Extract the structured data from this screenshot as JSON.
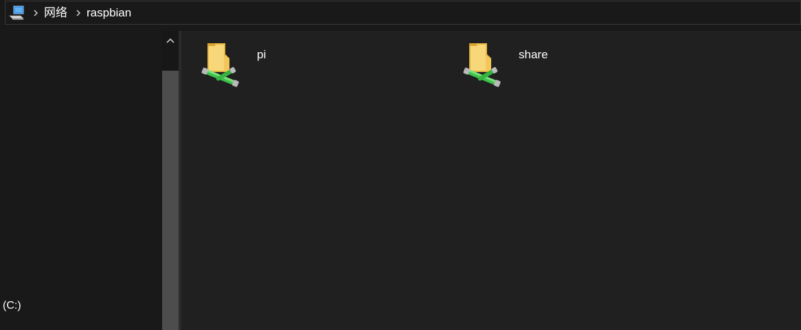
{
  "address_bar": {
    "location_icon": "network-computer-icon",
    "crumbs": [
      "网络",
      "raspbian"
    ],
    "separator_icon": "chevron-right-icon"
  },
  "nav_pane": {
    "drive_label": "(C:)"
  },
  "scrollbar": {
    "up_icon": "caret-up-icon"
  },
  "content": {
    "items": [
      {
        "label": "pi",
        "icon": "shared-folder-icon"
      },
      {
        "label": "share",
        "icon": "shared-folder-icon"
      }
    ]
  },
  "colors": {
    "background": "#191919",
    "content_background": "#202020",
    "folder_yellow": "#f5c94a",
    "network_green": "#3bbf3b"
  }
}
